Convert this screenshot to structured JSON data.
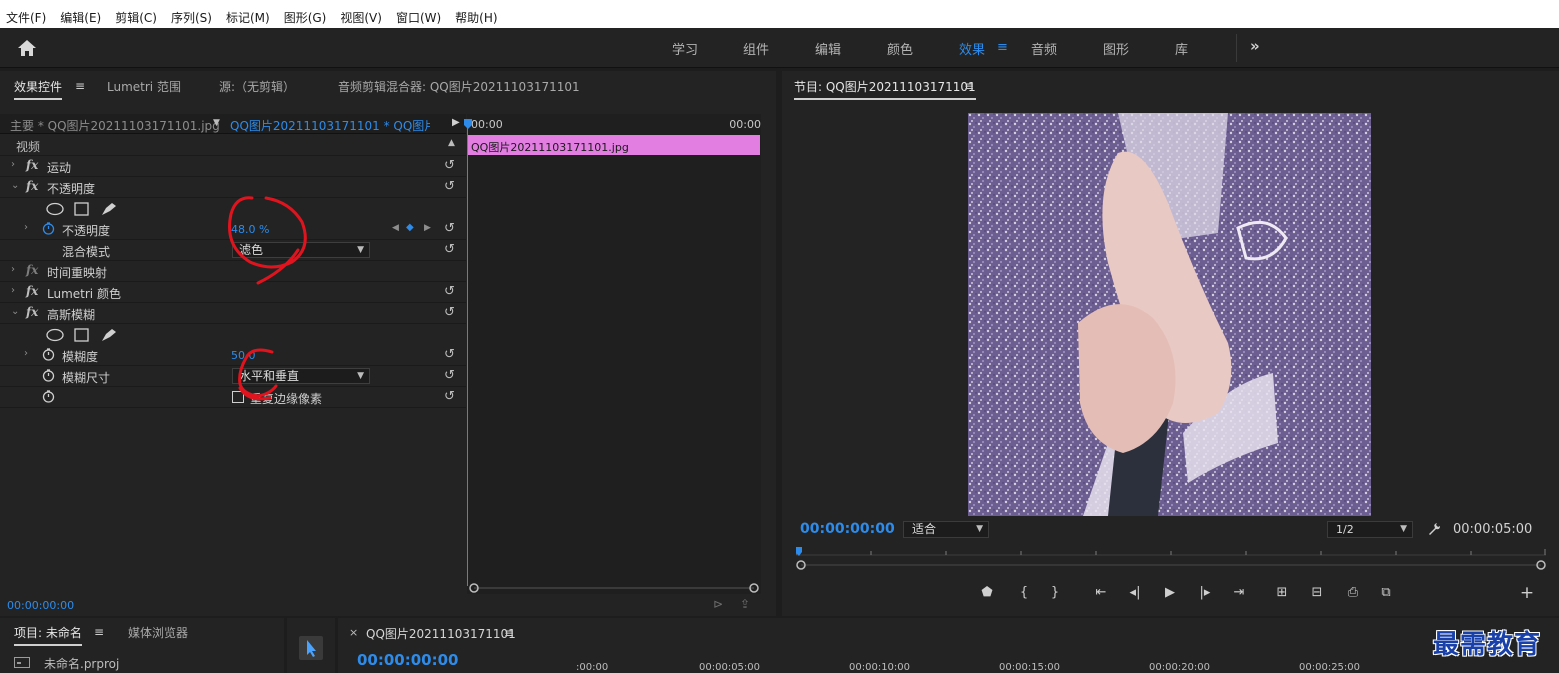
{
  "menu": [
    "文件(F)",
    "编辑(E)",
    "剪辑(C)",
    "序列(S)",
    "标记(M)",
    "图形(G)",
    "视图(V)",
    "窗口(W)",
    "帮助(H)"
  ],
  "workspaces": {
    "learn": "学习",
    "assembly": "组件",
    "editing": "编辑",
    "color": "颜色",
    "effects": "效果",
    "audio": "音频",
    "graphics": "图形",
    "libraries": "库",
    "menu_icon": "≡",
    "more": "»"
  },
  "effect_controls": {
    "tabs": {
      "effect_controls": "效果控件",
      "lumetri_scopes": "Lumetri 范围",
      "source": "源:（无剪辑）",
      "audio_mixer": "音频剪辑混合器: QQ图片20211103171101"
    },
    "menu_icon": "≡",
    "master_label": "主要 * QQ图片20211103171101.jpg",
    "clip_label": "QQ图片20211103171101 * QQ图片2...",
    "video_section": "视频",
    "motion": "运动",
    "opacity": "不透明度",
    "opacity_param": "不透明度",
    "opacity_value": "48.0 %",
    "blend_mode_label": "混合模式",
    "blend_mode_value": "滤色",
    "time_remap": "时间重映射",
    "lumetri": "Lumetri 颜色",
    "gaussian_blur": "高斯模糊",
    "blurriness_label": "模糊度",
    "blurriness_value": "50.0",
    "blur_dim_label": "模糊尺寸",
    "blur_dim_value": "水平和垂直",
    "repeat_edge": "重复边缘像素",
    "timeline_start": "00:00",
    "timeline_end": "00:00",
    "clip_bar": "QQ图片20211103171101.jpg",
    "timecode": "00:00:00:00"
  },
  "program": {
    "title": "节目: QQ图片20211103171101",
    "menu_icon": "≡",
    "timecode_current": "00:00:00:00",
    "timecode_duration": "00:00:05:00",
    "fit": "适合",
    "resolution": "1/2"
  },
  "project": {
    "tab_project": "项目: 未命名",
    "tab_media": "媒体浏览器",
    "menu_icon": "≡",
    "file": "未命名.prproj"
  },
  "timeline": {
    "sequence": "QQ图片20211103171101",
    "close": "×",
    "menu_icon": "≡",
    "timecode": "00:00:00:00",
    "marks": [
      ":00:00",
      "00:00:05:00",
      "00:00:10:00",
      "00:00:15:00",
      "00:00:20:00",
      "00:00:25:00"
    ]
  },
  "watermark": "最需教育",
  "colors": {
    "accent": "#2d8ceb",
    "clip": "#e27ee2",
    "annotation": "#e0141e"
  }
}
